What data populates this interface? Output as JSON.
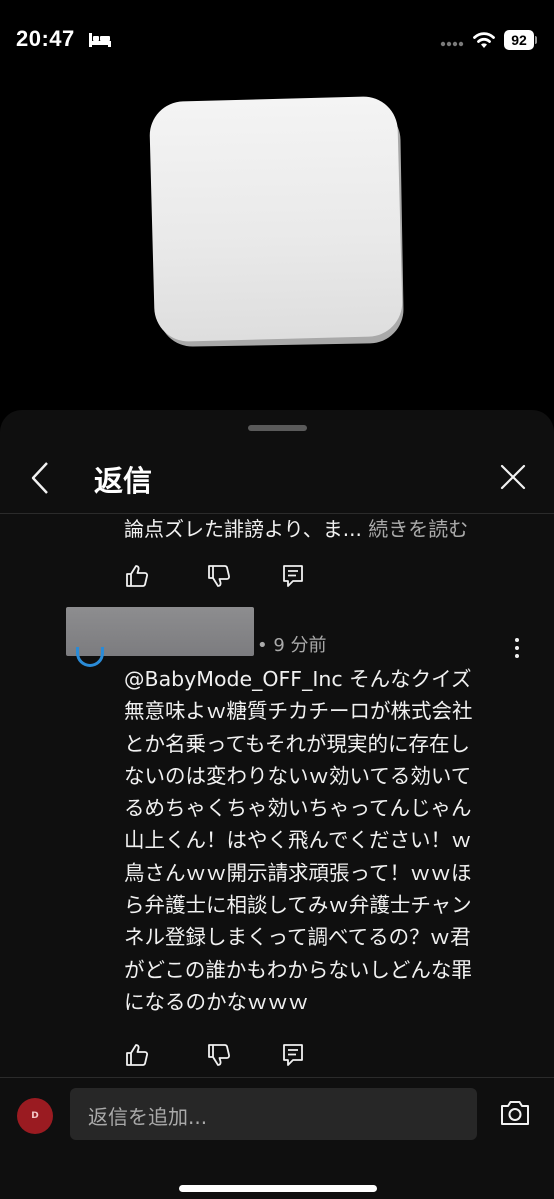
{
  "status_bar": {
    "time": "20:47",
    "battery": "92",
    "icons": [
      "bed-icon",
      "signal-dots-icon",
      "wifi-icon",
      "battery-icon"
    ]
  },
  "sheet": {
    "title": "返信",
    "icons": [
      "back-icon",
      "close-icon"
    ]
  },
  "previous_comment": {
    "text": "論点ズレた誹謗より、ま...",
    "read_more": "続きを読む"
  },
  "comment": {
    "meta": "• 9 分前",
    "lines": [
      "@BabyMode_OFF_Inc そんなクイズ",
      "無意味よｗ糖質チカチーロが株式会社",
      "とか名乗ってもそれが現実的に存在し",
      "ないのは変わりないｗ効いてる効いて",
      "るめちゃくちゃ効いちゃってんじゃん",
      "山上くん！はやく飛んでください！ｗ",
      "鳥さんｗｗ開示請求頑張って！ｗｗほ",
      "ら弁護士に相談してみｗ弁護士チャン",
      "ネル登録しまくって調べてるの？ｗ君",
      "がどこの誰かもわからないしどんな罪",
      "になるのかなｗｗｗ"
    ]
  },
  "action_icons": [
    "like-icon",
    "dislike-icon",
    "reply-icon"
  ],
  "input": {
    "avatar_letter": "D",
    "placeholder": "返信を追加...",
    "icons": [
      "camera-icon"
    ]
  },
  "colors": {
    "background": "#000000",
    "sheet": "#0f0f0f",
    "text": "#f1f1f1",
    "secondary_text": "#aaaaaa",
    "input_bg": "#272727",
    "avatar": "#9a1b21"
  }
}
